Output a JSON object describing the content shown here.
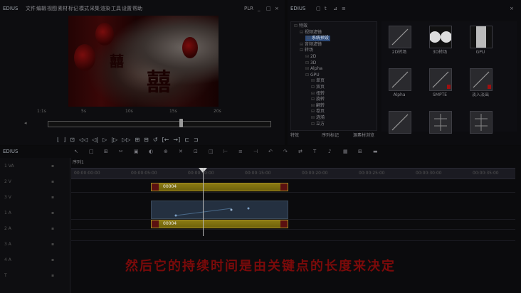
{
  "player": {
    "app_name": "EDIUS",
    "menu": [
      "文件",
      "编辑",
      "视图",
      "素材",
      "标记",
      "模式",
      "采集",
      "渲染",
      "工具",
      "设置",
      "帮助"
    ],
    "mode_label": "PLR",
    "window_controls": [
      "_",
      "□",
      "×"
    ],
    "time_marks": [
      "1:1s",
      "5s",
      "10s",
      "15s",
      "20s"
    ],
    "transport_buttons": [
      "⌊",
      "⌋",
      "⊡",
      "◁◁",
      "◁|",
      "▷",
      "|▷",
      "▷▷",
      "⊞",
      "⊟",
      "↺",
      "[←",
      "→]",
      "⊏",
      "⊐"
    ]
  },
  "effects": {
    "app_name": "EDIUS",
    "toolbar_icons": [
      "folder-icon",
      "text-icon",
      "filter-icon",
      "list-icon"
    ],
    "tree": [
      {
        "label": "特效",
        "depth": 0
      },
      {
        "label": "视频滤镜",
        "depth": 1
      },
      {
        "label": "系统预设",
        "depth": 2,
        "selected": true
      },
      {
        "label": "音频滤镜",
        "depth": 1
      },
      {
        "label": "转场",
        "depth": 1
      },
      {
        "label": "2D",
        "depth": 2
      },
      {
        "label": "3D",
        "depth": 2
      },
      {
        "label": "Alpha",
        "depth": 2
      },
      {
        "label": "GPU",
        "depth": 2
      },
      {
        "label": "单页",
        "depth": 3
      },
      {
        "label": "双页",
        "depth": 3
      },
      {
        "label": "扭转",
        "depth": 3
      },
      {
        "label": "旋转",
        "depth": 3
      },
      {
        "label": "翻转",
        "depth": 3
      },
      {
        "label": "卷页",
        "depth": 3
      },
      {
        "label": "涟漪",
        "depth": 3
      },
      {
        "label": "立方",
        "depth": 3
      }
    ],
    "grid_items": [
      {
        "label": "2D转场"
      },
      {
        "label": "3D转场"
      },
      {
        "label": "GPU"
      },
      {
        "label": "Alpha"
      },
      {
        "label": "SMPTE"
      },
      {
        "label": "淡入淡出"
      },
      {
        "label": ""
      },
      {
        "label": ""
      },
      {
        "label": ""
      }
    ],
    "bottom_tabs": [
      "特效",
      "序列标记",
      "源素材浏览"
    ]
  },
  "timeline": {
    "app_name": "EDIUS",
    "sequence_label": "序列1",
    "ruler_marks": [
      "00:00:00:00",
      "00:00:05:00",
      "00:00:10:00",
      "00:00:15:00",
      "00:00:20:00",
      "00:00:25:00",
      "00:00:30:00",
      "00:00:35:00"
    ],
    "clips": [
      {
        "label": "00004",
        "color": "#8a7a12"
      },
      {
        "label": "00004",
        "color": "#8a7a12"
      }
    ],
    "track_headers": [
      {
        "label": "1 VA"
      },
      {
        "label": "2 V"
      },
      {
        "label": "3 V"
      },
      {
        "label": "1 A"
      },
      {
        "label": "2 A"
      },
      {
        "label": "3 A"
      },
      {
        "label": "4 A"
      },
      {
        "label": "T"
      }
    ]
  },
  "subtitle": "然后它的持续时间是由关键点的长度来决定"
}
